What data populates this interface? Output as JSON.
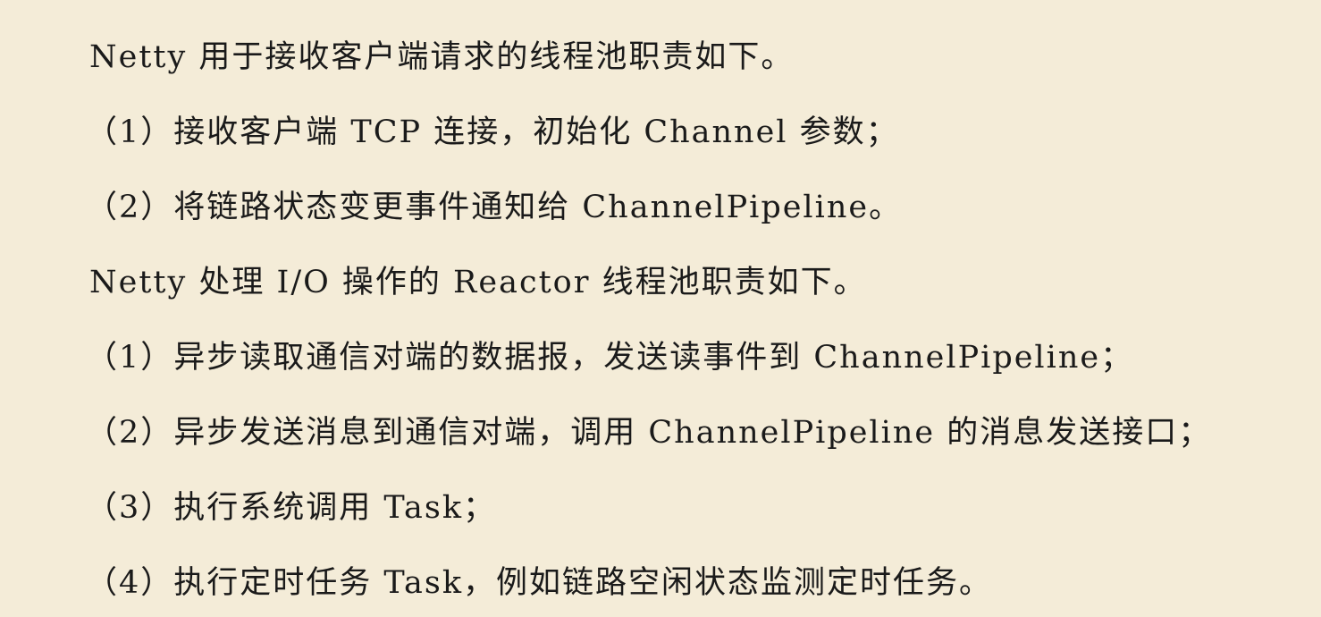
{
  "document": {
    "lines": [
      "Netty 用于接收客户端请求的线程池职责如下。",
      "（1）接收客户端 TCP 连接，初始化 Channel 参数；",
      "（2）将链路状态变更事件通知给 ChannelPipeline。",
      "Netty 处理 I/O 操作的 Reactor 线程池职责如下。",
      "（1）异步读取通信对端的数据报，发送读事件到 ChannelPipeline；",
      "（2）异步发送消息到通信对端，调用 ChannelPipeline 的消息发送接口；",
      "（3）执行系统调用 Task；",
      "（4）执行定时任务 Task，例如链路空闲状态监测定时任务。"
    ]
  }
}
